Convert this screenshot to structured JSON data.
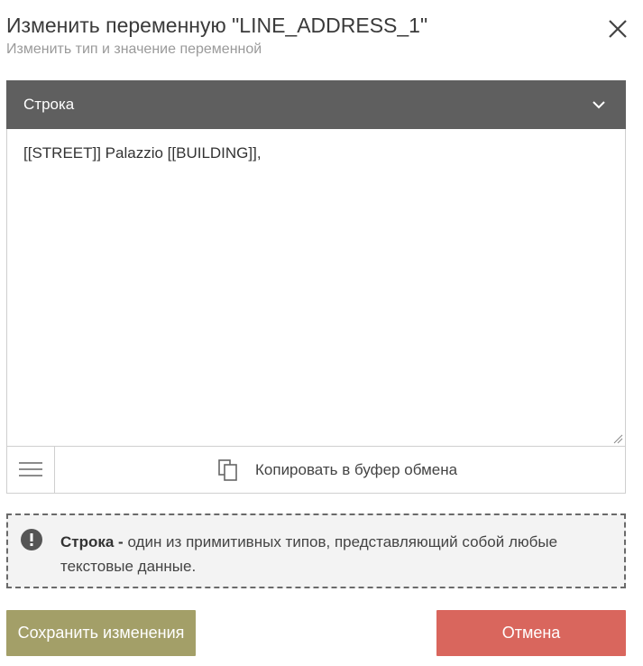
{
  "dialog": {
    "title": "Изменить переменную \"LINE_ADDRESS_1\"",
    "subtitle": "Изменить тип и значение переменной",
    "close_icon": "close-icon"
  },
  "type_select": {
    "selected": "Строка",
    "icon": "chevron-down-icon"
  },
  "editor": {
    "value": "[[STREET]] Palazzio [[BUILDING]],"
  },
  "toolbar": {
    "menu_icon": "hamburger-menu-icon",
    "copy_icon": "copy-icon",
    "copy_label": "Копировать в буфер обмена"
  },
  "info": {
    "icon": "exclamation-circle-icon",
    "term": "Строка -",
    "description": " один из примитивных типов, представляющий собой любые текстовые данные."
  },
  "actions": {
    "save_label": "Сохранить изменения",
    "cancel_label": "Отмена"
  },
  "colors": {
    "select_bg": "#5f5f5f",
    "save_bg": "#a39f68",
    "cancel_bg": "#d9665d",
    "info_bg": "#f3f3f3"
  }
}
